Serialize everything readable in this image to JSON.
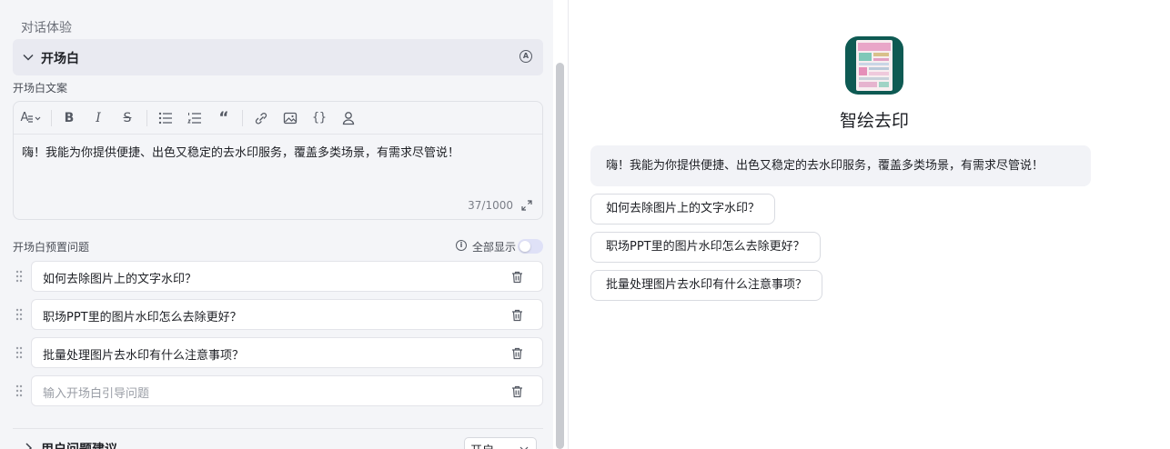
{
  "config": {
    "section_title": "对话体验",
    "accordion_title": "开场白",
    "accordion_badge": "A",
    "opening_label": "开场白文案",
    "editor": {
      "toolbar": {
        "font_glyph": "A",
        "bold": "B",
        "italic": "I",
        "strike": "S",
        "code": "{}"
      },
      "text": "嗨！我能为你提供便捷、出色又稳定的去水印服务，覆盖多类场景，有需求尽管说！",
      "count": "37/1000"
    },
    "preset_label": "开场白预置问题",
    "show_all_label": "全部显示",
    "show_all_enabled": false,
    "questions": [
      "如何去除图片上的文字水印？",
      "职场PPT里的图片水印怎么去除更好？",
      "批量处理图片去水印有什么注意事项？"
    ],
    "question_placeholder": "输入开场白引导问题",
    "next_section": {
      "title": "用户问题建议",
      "select_value": "开启"
    }
  },
  "preview": {
    "app_name": "智绘去印",
    "greeting": "嗨！我能为你提供便捷、出色又稳定的去水印服务，覆盖多类场景，有需求尽管说！",
    "suggestions": [
      "如何去除图片上的文字水印？",
      "职场PPT里的图片水印怎么去除更好？",
      "批量处理图片去水印有什么注意事项？"
    ]
  },
  "colors": {
    "panel_bg": "#f4f5f8",
    "accordion_bg": "#e9eaf1",
    "app_icon_bg": "#0e5a53",
    "toggle_off": "#dfe1f7"
  }
}
